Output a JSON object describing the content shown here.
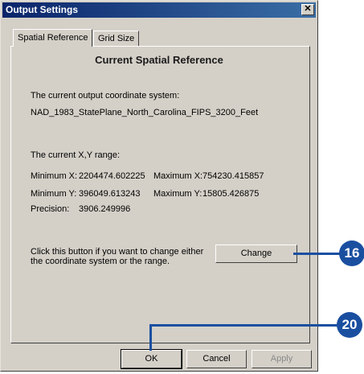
{
  "window": {
    "title": "Output Settings",
    "close_label": "✕"
  },
  "tabs": [
    {
      "label": "Spatial Reference",
      "active": true
    },
    {
      "label": "Grid Size",
      "active": false
    }
  ],
  "panel": {
    "heading": "Current Spatial Reference",
    "coord_system_label": "The current output coordinate system:",
    "coord_system_value": "NAD_1983_StatePlane_North_Carolina_FIPS_3200_Feet",
    "range_label": "The current X,Y range:",
    "min_x_label": "Minimum X:",
    "min_x_value": "2204474.602225",
    "max_x_label": "Maximum X:",
    "max_x_value": "754230.415857",
    "min_y_label": "Minimum Y:",
    "min_y_value": "396049.613243",
    "max_y_label": "Maximum Y:",
    "max_y_value": "15805.426875",
    "precision_label": "Precision:",
    "precision_value": "3906.249996",
    "change_hint_line1": "Click this button if you want to change either",
    "change_hint_line2": "the coordinate system or the range.",
    "change_button": "Change"
  },
  "footer": {
    "ok": "OK",
    "cancel": "Cancel",
    "apply": "Apply"
  },
  "callouts": {
    "change_step": "16",
    "ok_step": "20"
  },
  "colors": {
    "titlebar_start": "#0a246a",
    "titlebar_end": "#3a6ea5",
    "callout": "#1a4fa0",
    "dialog_bg": "#d4d0c8"
  }
}
